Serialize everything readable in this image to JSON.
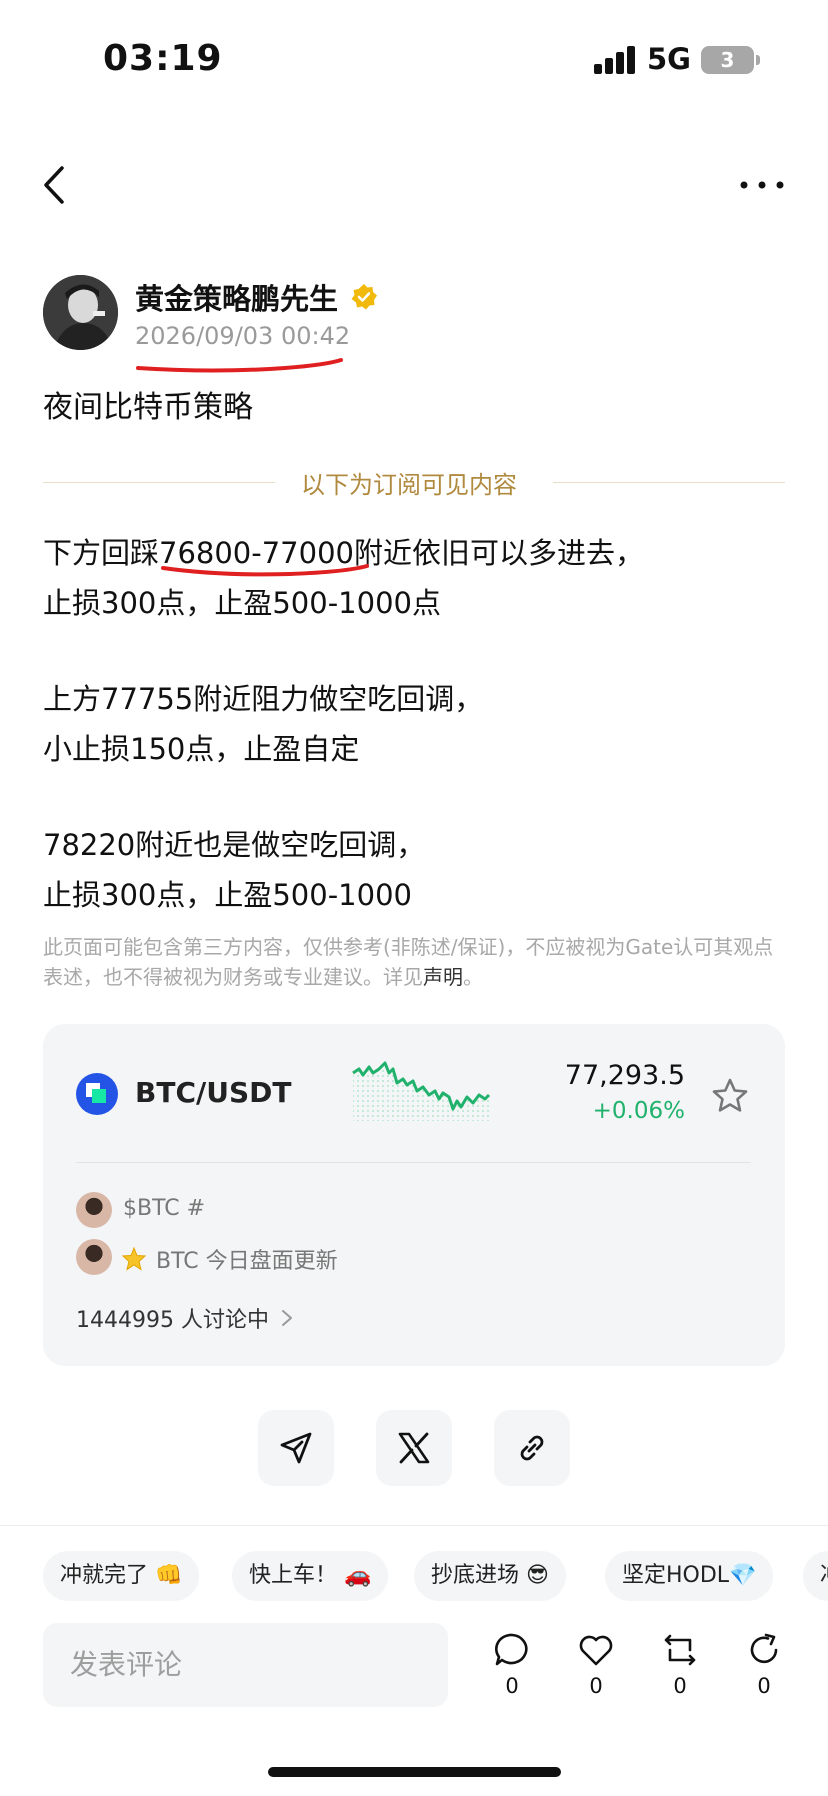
{
  "status_bar": {
    "time": "03:19",
    "network": "5G",
    "battery": "3"
  },
  "nav": {
    "back_icon": "chevron-left-icon",
    "more_icon": "ellipsis-icon"
  },
  "post": {
    "author_name": "黄金策略鹏先生",
    "date": "2026/09/03 00:42",
    "title": "夜间比特币策略",
    "subscriber_divider": "以下为订阅可见内容",
    "lines": [
      "下方回踩76800-77000附近依旧可以多进去，",
      "止损300点，止盈500-1000点",
      "上方77755附近阻力做空吃回调，",
      "小止损150点，止盈自定",
      "78220附近也是做空吃回调，",
      "止损300点，止盈500-1000"
    ],
    "disclaimer": "此页面可能包含第三方内容，仅供参考(非陈述/保证)，不应被视为Gate认可其观点表述，也不得被视为财务或专业建议。详见",
    "disclaimer_link": "声明",
    "disclaimer_end": "。"
  },
  "market_card": {
    "pair": "BTC/USDT",
    "price": "77,293.5",
    "change": "+0.06%",
    "topics": [
      {
        "text": "$BTC #"
      },
      {
        "text": "BTC 今日盘面更新"
      }
    ],
    "discussion": "1444995 人讨论中"
  },
  "share": {
    "items": [
      "send-icon",
      "x-icon",
      "link-icon"
    ]
  },
  "chips": [
    "冲就完了 👊",
    "快上车！ 🚗",
    "抄底进场 😎",
    "坚定HODL💎",
    "冲"
  ],
  "comment": {
    "placeholder": "发表评论"
  },
  "actions": [
    {
      "icon": "comment-icon",
      "count": "0"
    },
    {
      "icon": "heart-icon",
      "count": "0"
    },
    {
      "icon": "repost-icon",
      "count": "0"
    },
    {
      "icon": "share-icon",
      "count": "0"
    }
  ],
  "colors": {
    "accent_gold": "#b08a3e",
    "up_green": "#20b26c",
    "brand_blue": "#2354e6",
    "annotation_red": "#e02020"
  }
}
